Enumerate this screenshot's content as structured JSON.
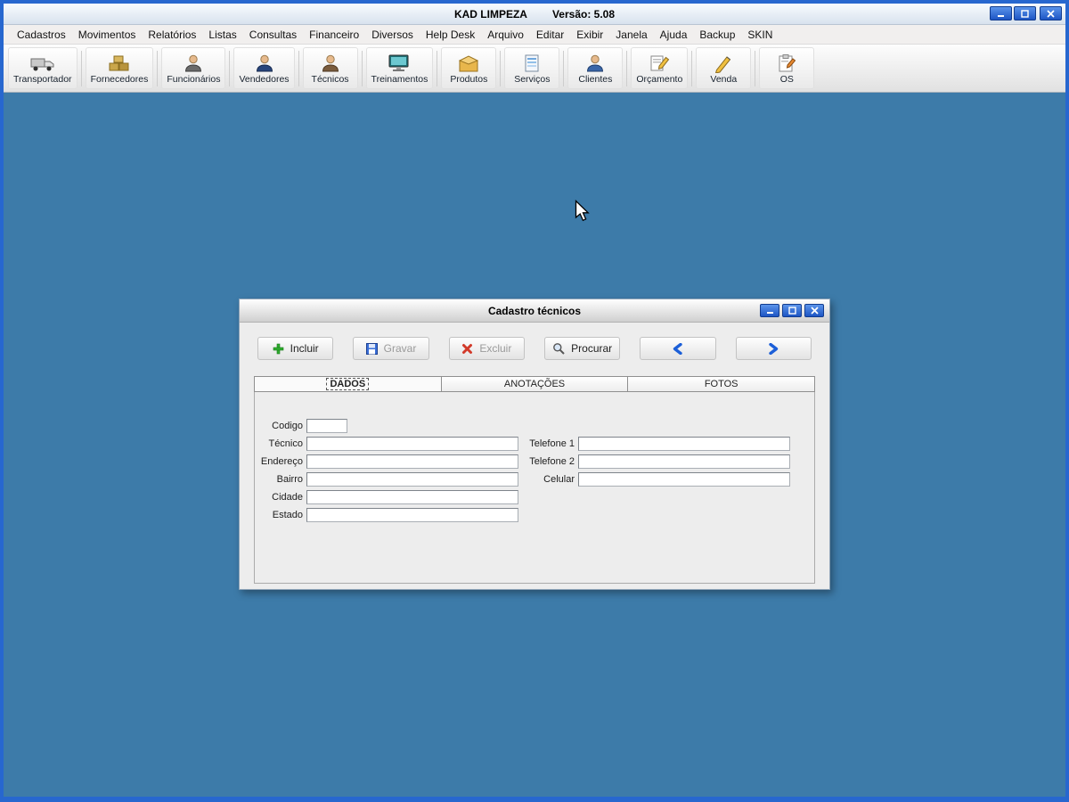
{
  "window": {
    "app_name": "KAD LIMPEZA",
    "version_label": "Versão: 5.08",
    "controls": [
      {
        "name": "minimize-button",
        "icon": "minimize-icon"
      },
      {
        "name": "maximize-button",
        "icon": "maximize-icon"
      },
      {
        "name": "close-button",
        "icon": "close-icon"
      }
    ]
  },
  "menu": {
    "items": [
      "Cadastros",
      "Movimentos",
      "Relatórios",
      "Listas",
      "Consultas",
      "Financeiro",
      "Diversos",
      "Help Desk",
      "Arquivo",
      "Editar",
      "Exibir",
      "Janela",
      "Ajuda",
      "Backup",
      "SKIN"
    ]
  },
  "toolbar": {
    "items": [
      {
        "label": "Transportador",
        "icon": "truck-icon"
      },
      {
        "label": "Fornecedores",
        "icon": "boxes-icon"
      },
      {
        "label": "Funcionários",
        "icon": "employee-icon"
      },
      {
        "label": "Vendedores",
        "icon": "salesperson-icon"
      },
      {
        "label": "Técnicos",
        "icon": "technician-icon"
      },
      {
        "label": "Treinamentos",
        "icon": "monitor-icon"
      },
      {
        "label": "Produtos",
        "icon": "product-box-icon"
      },
      {
        "label": "Serviços",
        "icon": "services-document-icon"
      },
      {
        "label": "Clientes",
        "icon": "client-icon"
      },
      {
        "label": "Orçamento",
        "icon": "budget-pencil-icon"
      },
      {
        "label": "Venda",
        "icon": "sale-pencil-icon"
      },
      {
        "label": "OS",
        "icon": "order-clipboard-icon"
      }
    ]
  },
  "dialog": {
    "title": "Cadastro técnicos",
    "controls": [
      {
        "name": "dialog-minimize-button",
        "icon": "minimize-icon"
      },
      {
        "name": "dialog-maximize-button",
        "icon": "maximize-icon"
      },
      {
        "name": "dialog-close-button",
        "icon": "close-icon"
      }
    ],
    "toolbar": [
      {
        "name": "incluir-button",
        "label": "Incluir",
        "icon": "plus-icon",
        "enabled": true
      },
      {
        "name": "gravar-button",
        "label": "Gravar",
        "icon": "save-icon",
        "enabled": false
      },
      {
        "name": "excluir-button",
        "label": "Excluir",
        "icon": "delete-icon",
        "enabled": false
      },
      {
        "name": "procurar-button",
        "label": "Procurar",
        "icon": "search-icon",
        "enabled": true
      },
      {
        "name": "previous-record-button",
        "label": "",
        "icon": "arrow-left-icon",
        "enabled": true
      },
      {
        "name": "next-record-button",
        "label": "",
        "icon": "arrow-right-icon",
        "enabled": true
      }
    ],
    "tabs": [
      {
        "label": "DADOS",
        "active": true
      },
      {
        "label": "ANOTAÇÕES",
        "active": false
      },
      {
        "label": "FOTOS",
        "active": false
      }
    ],
    "form": {
      "left_fields": [
        {
          "label": "Codigo",
          "value": "",
          "small": true
        },
        {
          "label": "Técnico",
          "value": ""
        },
        {
          "label": "Endereço",
          "value": ""
        },
        {
          "label": "Bairro",
          "value": ""
        },
        {
          "label": "Cidade",
          "value": ""
        },
        {
          "label": "Estado",
          "value": ""
        }
      ],
      "right_fields": [
        {
          "label": "Telefone 1",
          "value": ""
        },
        {
          "label": "Telefone 2",
          "value": ""
        },
        {
          "label": "Celular",
          "value": ""
        }
      ]
    }
  }
}
